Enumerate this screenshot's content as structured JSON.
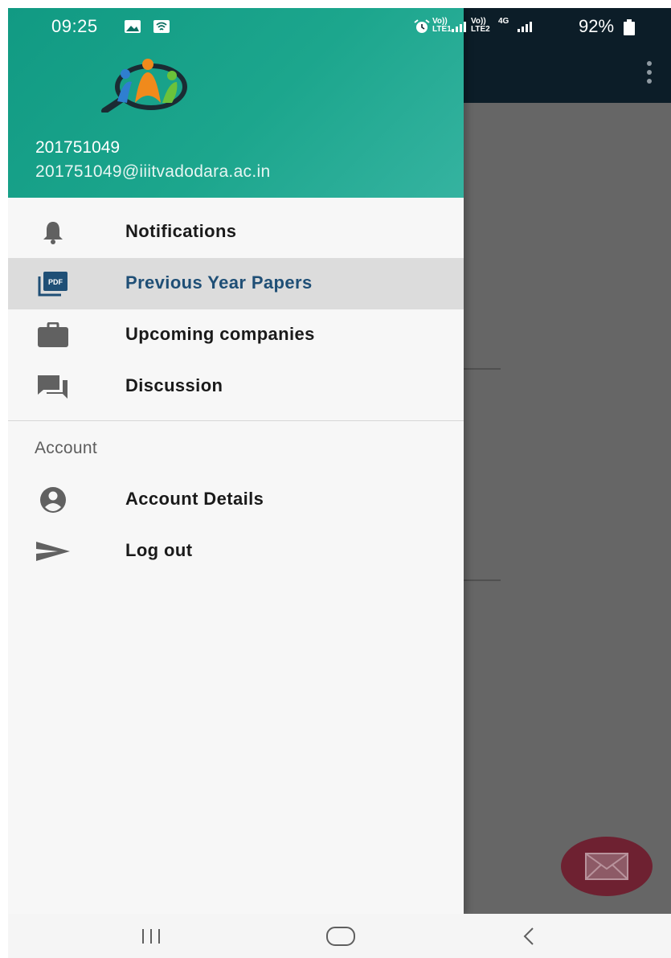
{
  "status_bar": {
    "time": "09:25",
    "battery": "92%",
    "sim1_label_top": "Vo))",
    "sim1_label_bottom": "LTE1",
    "sim2_label_top": "Vo))",
    "sim2_label_bottom": "LTE2",
    "network_type": "4G",
    "icons": [
      "image-icon",
      "wifi-icon",
      "alarm-icon",
      "signal-icon",
      "battery-icon"
    ]
  },
  "drawer": {
    "header": {
      "user_id": "201751049",
      "email": "201751049@iiitvadodara.ac.in"
    },
    "items": [
      {
        "label": "Notifications",
        "icon": "bell-icon",
        "selected": false
      },
      {
        "label": "Previous Year Papers",
        "icon": "pdf-icon",
        "selected": true
      },
      {
        "label": "Upcoming companies",
        "icon": "briefcase-icon",
        "selected": false
      },
      {
        "label": "Discussion",
        "icon": "forum-icon",
        "selected": false
      }
    ],
    "account_section": {
      "header": "Account",
      "items": [
        {
          "label": "Account Details",
          "icon": "account-circle-icon"
        },
        {
          "label": "Log out",
          "icon": "send-icon"
        }
      ]
    }
  },
  "colors": {
    "header_gradient_start": "#119a83",
    "header_gradient_end": "#35b3a0",
    "app_bar": "#0c1d28",
    "selected_text": "#1f4f76",
    "fab": "#6e2131"
  },
  "fab": {
    "icon": "mail-icon"
  },
  "system_nav": {
    "icons": [
      "recents-icon",
      "home-icon",
      "back-icon"
    ]
  }
}
